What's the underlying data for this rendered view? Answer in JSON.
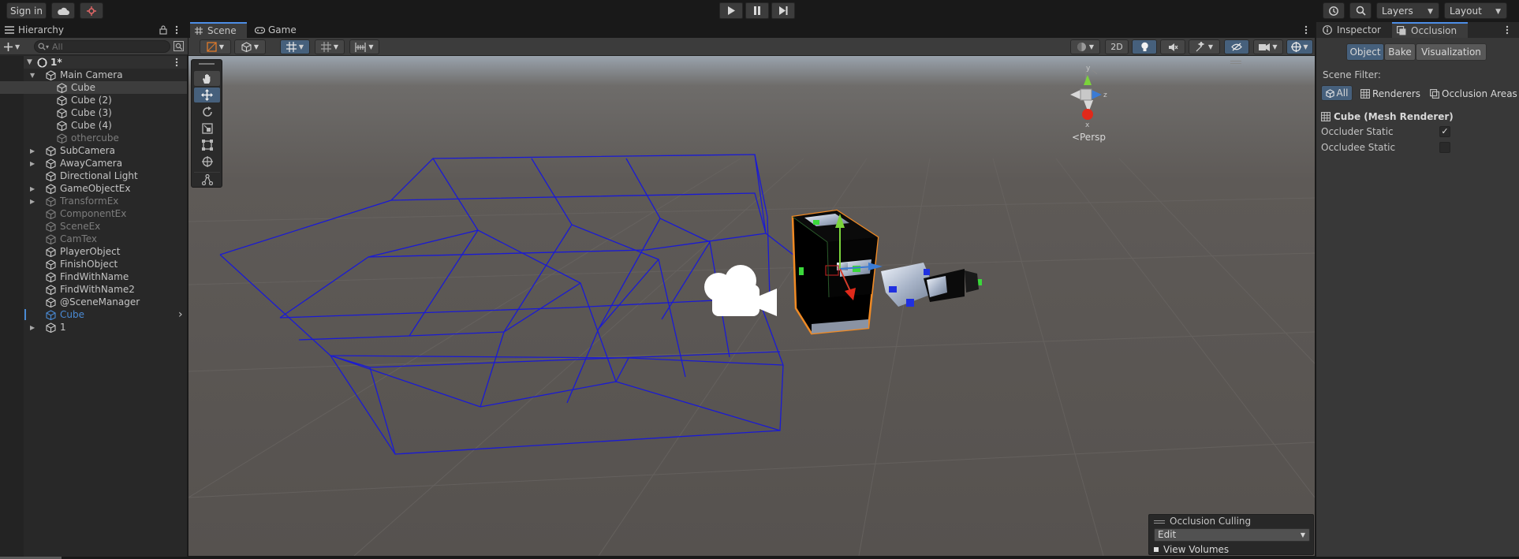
{
  "topbar": {
    "sign_in": "Sign in",
    "layers": "Layers",
    "layout": "Layout"
  },
  "hierarchy": {
    "tab": "Hierarchy",
    "search_placeholder": "All",
    "scene": "1*",
    "items": [
      {
        "label": "Main Camera",
        "depth": 1,
        "expand": "open",
        "state": "normal"
      },
      {
        "label": "Cube",
        "depth": 2,
        "expand": "none",
        "state": "selected"
      },
      {
        "label": "Cube (2)",
        "depth": 2,
        "expand": "none",
        "state": "normal"
      },
      {
        "label": "Cube (3)",
        "depth": 2,
        "expand": "none",
        "state": "normal"
      },
      {
        "label": "Cube (4)",
        "depth": 2,
        "expand": "none",
        "state": "normal"
      },
      {
        "label": "othercube",
        "depth": 2,
        "expand": "none",
        "state": "dim"
      },
      {
        "label": "SubCamera",
        "depth": 1,
        "expand": "closed",
        "state": "normal"
      },
      {
        "label": "AwayCamera",
        "depth": 1,
        "expand": "closed",
        "state": "normal"
      },
      {
        "label": "Directional Light",
        "depth": 1,
        "expand": "none",
        "state": "normal"
      },
      {
        "label": "GameObjectEx",
        "depth": 1,
        "expand": "closed",
        "state": "normal"
      },
      {
        "label": "TransformEx",
        "depth": 1,
        "expand": "closed",
        "state": "dim"
      },
      {
        "label": "ComponentEx",
        "depth": 1,
        "expand": "none",
        "state": "dim"
      },
      {
        "label": "SceneEx",
        "depth": 1,
        "expand": "none",
        "state": "dim"
      },
      {
        "label": "CamTex",
        "depth": 1,
        "expand": "none",
        "state": "dim"
      },
      {
        "label": "PlayerObject",
        "depth": 1,
        "expand": "none",
        "state": "normal"
      },
      {
        "label": "FinishObject",
        "depth": 1,
        "expand": "none",
        "state": "normal"
      },
      {
        "label": "FindWithName",
        "depth": 1,
        "expand": "none",
        "state": "normal"
      },
      {
        "label": "FindWithName2",
        "depth": 1,
        "expand": "none",
        "state": "normal"
      },
      {
        "label": "@SceneManager",
        "depth": 1,
        "expand": "none",
        "state": "normal"
      },
      {
        "label": "Cube",
        "depth": 1,
        "expand": "none",
        "state": "prefab"
      },
      {
        "label": "1",
        "depth": 1,
        "expand": "closed",
        "state": "normal"
      }
    ]
  },
  "scene": {
    "tabs": [
      "Scene",
      "Game"
    ],
    "toolbar_2d": "2D",
    "persp": "Persp",
    "gizmo_axes": {
      "y": "y",
      "z": "z",
      "x": "x"
    }
  },
  "occlusion_overlay": {
    "title": "Occlusion Culling",
    "mode": "Edit",
    "view_volumes": "View Volumes"
  },
  "inspector": {
    "tabs": [
      "Inspector",
      "Occlusion"
    ],
    "mode_buttons": [
      "Object",
      "Bake",
      "Visualization"
    ],
    "scene_filter_label": "Scene Filter:",
    "filters": [
      "All",
      "Renderers",
      "Occlusion Areas"
    ],
    "component": "Cube (Mesh Renderer)",
    "occluder_static": "Occluder Static",
    "occluder_static_checked": true,
    "occludee_static": "Occludee Static",
    "occludee_static_checked": false,
    "checkmark": "✓"
  },
  "colors": {
    "accent": "#4d8ee6",
    "selection": "#46607c",
    "wire_volume": "#1a1ad4",
    "outline": "#f08a24"
  }
}
